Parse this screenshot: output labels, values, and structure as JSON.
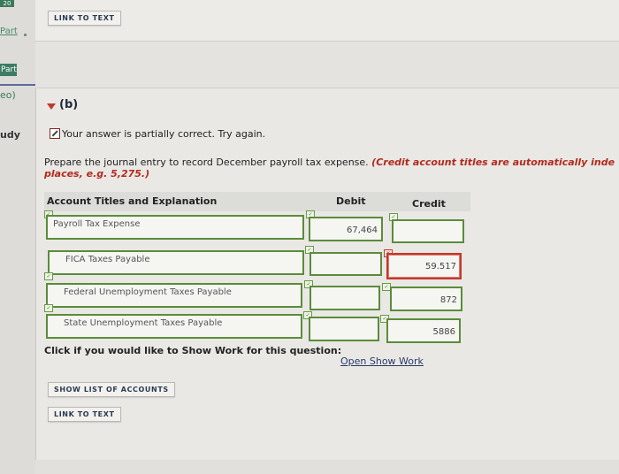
{
  "sidebar": {
    "top_badge": "20",
    "item_part_link": "Part",
    "item_part_active": "Part",
    "item_eo": "eo)",
    "item_udy": "udy"
  },
  "top_panel": {
    "link_to_text": "LINK TO TEXT"
  },
  "section": {
    "label": "(b)"
  },
  "feedback": {
    "status_text": "Your answer is partially correct.  Try again."
  },
  "instruction": {
    "prefix": "Prepare the journal entry to record December payroll tax expense. ",
    "red_part": "(Credit account titles are automatically inde",
    "red_line2": "places, e.g. 5,275.)"
  },
  "table": {
    "headers": {
      "account": "Account Titles and Explanation",
      "debit": "Debit",
      "credit": "Credit"
    },
    "rows": [
      {
        "account": "Payroll Tax Expense",
        "debit": "67,464",
        "credit": ""
      },
      {
        "account": "FICA Taxes Payable",
        "debit": "",
        "credit": "59.517"
      },
      {
        "account": "Federal Unemployment Taxes Payable",
        "debit": "",
        "credit": "872"
      },
      {
        "account": "State Unemployment Taxes Payable",
        "debit": "",
        "credit": "5886"
      }
    ]
  },
  "show_work": {
    "prompt": "Click if you would like to Show Work for this question:",
    "link": "Open Show Work"
  },
  "buttons": {
    "show_list": "SHOW LIST OF ACCOUNTS",
    "link_to_text": "LINK TO TEXT"
  },
  "colors": {
    "correct_border": "#5b8c3a",
    "error_border": "#c0392b",
    "accent_red": "#b32a1e"
  }
}
